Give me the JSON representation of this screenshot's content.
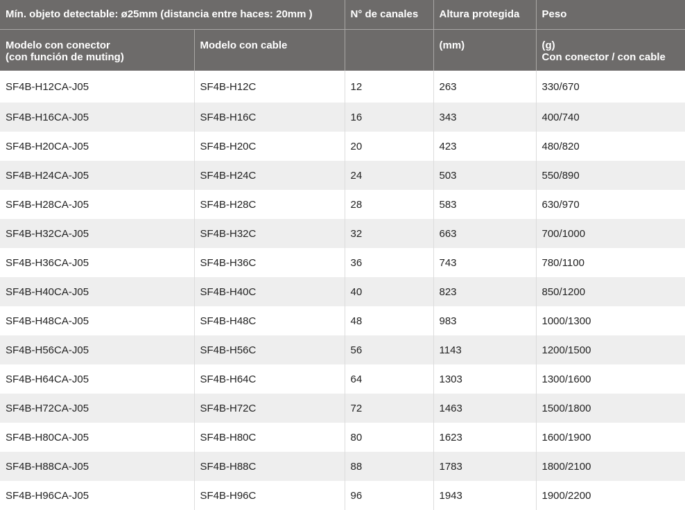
{
  "table": {
    "header_row1": {
      "title": "Mín. objeto detectable: ø25mm (distancia entre haces: 20mm )",
      "channels": "N° de canales",
      "height": "Altura protegida",
      "weight": "Peso"
    },
    "header_row2": {
      "connector_model_l1": "Modelo con conector",
      "connector_model_l2": "(con función de muting)",
      "cable_model": "Modelo con cable",
      "channels": "",
      "height_unit": "(mm)",
      "weight_unit": "(g)",
      "weight_desc": "Con conector / con cable"
    },
    "rows": [
      [
        "SF4B-H12CA-J05",
        "SF4B-H12C",
        "12",
        "263",
        "330/670"
      ],
      [
        "SF4B-H16CA-J05",
        "SF4B-H16C",
        "16",
        "343",
        "400/740"
      ],
      [
        "SF4B-H20CA-J05",
        "SF4B-H20C",
        "20",
        "423",
        "480/820"
      ],
      [
        "SF4B-H24CA-J05",
        "SF4B-H24C",
        "24",
        "503",
        "550/890"
      ],
      [
        "SF4B-H28CA-J05",
        "SF4B-H28C",
        "28",
        "583",
        "630/970"
      ],
      [
        "SF4B-H32CA-J05",
        "SF4B-H32C",
        "32",
        "663",
        "700/1000"
      ],
      [
        "SF4B-H36CA-J05",
        "SF4B-H36C",
        "36",
        "743",
        "780/1100"
      ],
      [
        "SF4B-H40CA-J05",
        "SF4B-H40C",
        "40",
        "823",
        "850/1200"
      ],
      [
        "SF4B-H48CA-J05",
        "SF4B-H48C",
        "48",
        "983",
        "1000/1300"
      ],
      [
        "SF4B-H56CA-J05",
        "SF4B-H56C",
        "56",
        "1143",
        "1200/1500"
      ],
      [
        "SF4B-H64CA-J05",
        "SF4B-H64C",
        "64",
        "1303",
        "1300/1600"
      ],
      [
        "SF4B-H72CA-J05",
        "SF4B-H72C",
        "72",
        "1463",
        "1500/1800"
      ],
      [
        "SF4B-H80CA-J05",
        "SF4B-H80C",
        "80",
        "1623",
        "1600/1900"
      ],
      [
        "SF4B-H88CA-J05",
        "SF4B-H88C",
        "88",
        "1783",
        "1800/2100"
      ],
      [
        "SF4B-H96CA-J05",
        "SF4B-H96C",
        "96",
        "1943",
        "1900/2200"
      ]
    ]
  },
  "colors": {
    "header_bg": "#6d6b6a",
    "header_text": "#ffffff",
    "row_alt_bg": "#eeeeee"
  }
}
